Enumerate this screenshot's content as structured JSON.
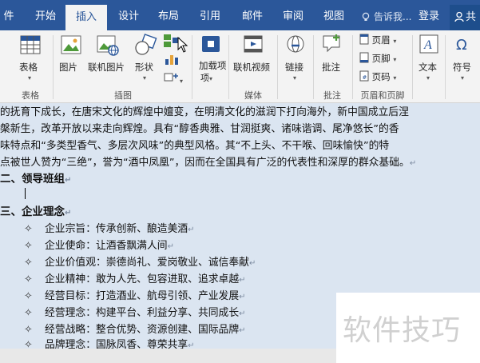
{
  "tabs": [
    {
      "label": "件"
    },
    {
      "label": "开始"
    },
    {
      "label": "插入"
    },
    {
      "label": "设计"
    },
    {
      "label": "布局"
    },
    {
      "label": "引用"
    },
    {
      "label": "邮件"
    },
    {
      "label": "审阅"
    },
    {
      "label": "视图"
    }
  ],
  "tell_me": "告诉我...",
  "login": "登录",
  "share": "共",
  "ribbon": {
    "tables": {
      "table": "表格",
      "group": "表格"
    },
    "illustrations": {
      "picture": "图片",
      "online_picture": "联机图片",
      "shapes": "形状",
      "group": "插图"
    },
    "addins": {
      "label": "加载项",
      "caret": "▾"
    },
    "media": {
      "online_video": "联机视频",
      "group": "媒体"
    },
    "links": {
      "link": "链接"
    },
    "comments": {
      "comment": "批注",
      "group": "批注"
    },
    "header_footer": {
      "header": "页眉",
      "footer": "页脚",
      "page_number": "页码",
      "group": "页眉和页脚"
    },
    "text": {
      "label": "文本"
    },
    "symbols": {
      "label": "符号"
    },
    "colors": {
      "accent": "#2b579a",
      "doc_bg": "#dbe5f1"
    }
  },
  "document": {
    "paragraphs": [
      "的抚育下成长，在唐宋文化的辉煌中嬗变，在明清文化的滋润下打向海外，新中国成立后涅",
      "槃新生，改革开放以来走向辉煌。具有“醇香典雅、甘润挺爽、诸味谐调、尾净悠长”的香",
      "味特点和“多类型香气、多层次风味”的典型风格。其“不上头、不干喉、回味愉快”的特",
      "点被世人赞为“三绝”，誉为“酒中凤凰”，因而在全国具有广泛的代表性和深厚的群众基础。"
    ],
    "heading2": "二、领导班组",
    "heading3": "三、企业理念",
    "bullet": "✧",
    "para_mark": "↵",
    "items": [
      "企业宗旨：传承创新、酿造美酒",
      "企业使命：让酒香飘满人间",
      "企业价值观：崇德尚礼、爱岗敬业、诚信奉献",
      "企业精神：敢为人先、包容进取、追求卓越",
      "经营目标：打造酒业、航母引领、产业发展",
      "经营理念：构建平台、利益分享、共同成长",
      "经营战略：整合优势、资源创建、国际品牌",
      "品牌理念：国脉凤香、尊荣共享"
    ]
  },
  "watermark": "软件技巧"
}
